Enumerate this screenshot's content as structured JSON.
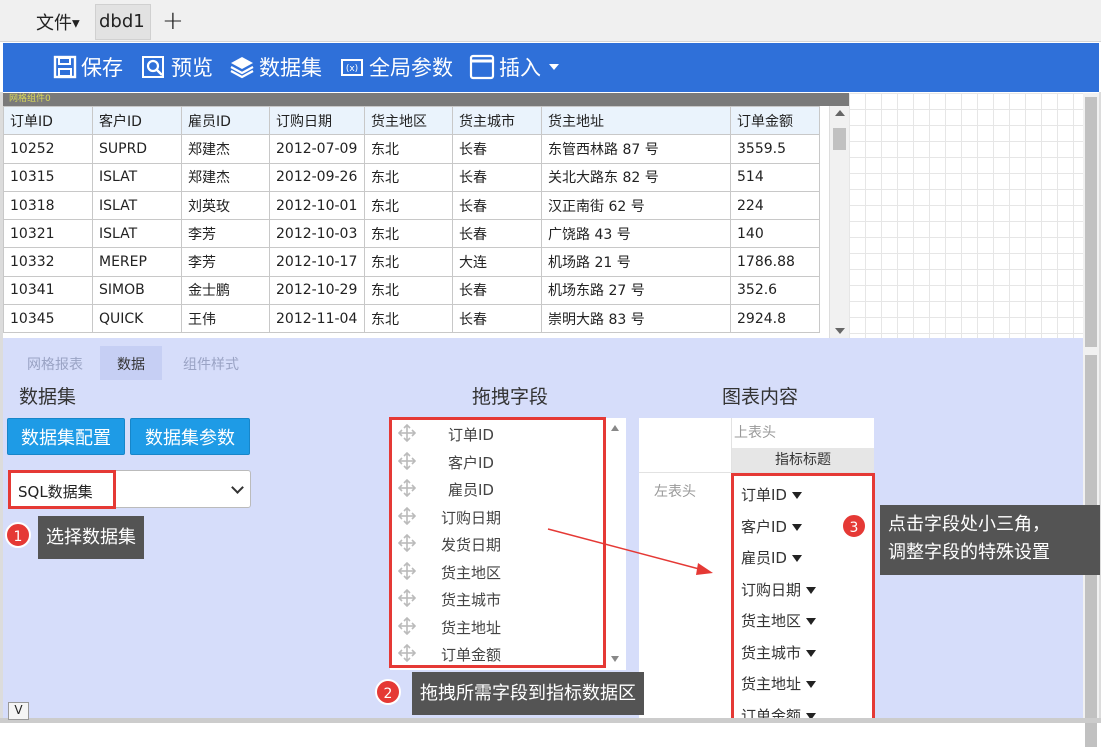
{
  "titlebar": {
    "file_menu": "文件",
    "tab": "dbd1",
    "add_tab": "+"
  },
  "toolbar": {
    "save": "保存",
    "preview": "预览",
    "dataset": "数据集",
    "global_params": "全局参数",
    "insert": "插入"
  },
  "grid_component_label": "网格组件0",
  "table": {
    "headers": [
      "订单ID",
      "客户ID",
      "雇员ID",
      "订购日期",
      "货主地区",
      "货主城市",
      "货主地址",
      "订单金额"
    ],
    "rows": [
      [
        "10252",
        "SUPRD",
        "郑建杰",
        "2012-07-09",
        "东北",
        "长春",
        "东管西林路 87 号",
        "3559.5"
      ],
      [
        "10315",
        "ISLAT",
        "郑建杰",
        "2012-09-26",
        "东北",
        "长春",
        "关北大路东 82 号",
        "514"
      ],
      [
        "10318",
        "ISLAT",
        "刘英玫",
        "2012-10-01",
        "东北",
        "长春",
        "汉正南街 62 号",
        "224"
      ],
      [
        "10321",
        "ISLAT",
        "李芳",
        "2012-10-03",
        "东北",
        "长春",
        "广饶路 43 号",
        "140"
      ],
      [
        "10332",
        "MEREP",
        "李芳",
        "2012-10-17",
        "东北",
        "大连",
        "机场路 21 号",
        "1786.88"
      ],
      [
        "10341",
        "SIMOB",
        "金士鹏",
        "2012-10-29",
        "东北",
        "长春",
        "机场东路 27 号",
        "352.6"
      ],
      [
        "10345",
        "QUICK",
        "王伟",
        "2012-11-04",
        "东北",
        "长春",
        "崇明大路 83 号",
        "2924.8"
      ]
    ]
  },
  "panel": {
    "tabs": [
      "网格报表",
      "数据",
      "组件样式"
    ],
    "dataset_title": "数据集",
    "drag_fields_title": "拖拽字段",
    "chart_content_title": "图表内容",
    "dataset_config_btn": "数据集配置",
    "dataset_params_btn": "数据集参数",
    "dataset_select": "SQL数据集",
    "fields": [
      "订单ID",
      "客户ID",
      "雇员ID",
      "订购日期",
      "发货日期",
      "货主地区",
      "货主城市",
      "货主地址",
      "订单金额"
    ],
    "upper_header": "上表头",
    "metric_title": "指标标题",
    "left_header": "左表头",
    "metric_fields": [
      "订单ID",
      "客户ID",
      "雇员ID",
      "订购日期",
      "货主地区",
      "货主城市",
      "货主地址",
      "订单金额"
    ]
  },
  "annotations": {
    "step1": {
      "num": "1",
      "text": "选择数据集"
    },
    "step2": {
      "num": "2",
      "text": "拖拽所需字段到指标数据区"
    },
    "step3": {
      "num": "3",
      "line1": "点击字段处小三角，",
      "line2": "调整字段的特殊设置"
    }
  },
  "colors": {
    "toolbar": "#2f70d9",
    "annotation_red": "#e53935",
    "button_blue": "#1e9be6",
    "panel_bg": "#d6ddfa"
  },
  "bottom_toggle": "V"
}
